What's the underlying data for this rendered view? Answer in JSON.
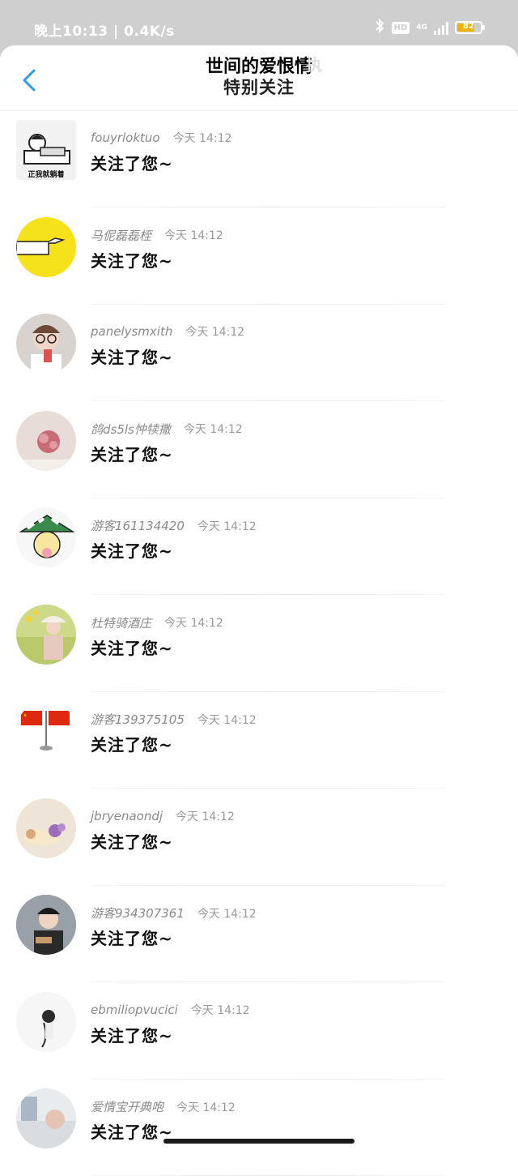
{
  "status_bar": {
    "time": "晚上10:13 | 0.4K/s",
    "hd": "HD",
    "network": "4G",
    "battery": "82",
    "battery_level": 0.82,
    "icons": [
      "bluetooth-icon",
      "hd-icon",
      "signal-icon",
      "battery-icon"
    ]
  },
  "header": {
    "title_main": "世间的爱恨情",
    "title_faded": "执",
    "subtitle": "特别关注",
    "back_icon": "chevron-left-icon"
  },
  "notifications": [
    {
      "name": "fouyrloktuo",
      "time": "今天 14:12",
      "message": "关注了您~",
      "avatar": "sleeping-cartoon",
      "avatar_color": "#f2f2f2",
      "avatar_text": "正我就躺着"
    },
    {
      "name": "马伲磊磊桎",
      "time": "今天 14:12",
      "message": "关注了您~",
      "avatar": "pointing-hand",
      "avatar_color": "#f5e21b"
    },
    {
      "name": "panelysmxith",
      "time": "今天 14:12",
      "message": "关注了您~",
      "avatar": "person-glasses",
      "avatar_color": "#d9d3cf"
    },
    {
      "name": "鸽ds5ls忡犊撒",
      "time": "今天 14:12",
      "message": "关注了您~",
      "avatar": "flower-bouquet",
      "avatar_color": "#e8dcd8"
    },
    {
      "name": "游客161134420",
      "time": "今天 14:12",
      "message": "关注了您~",
      "avatar": "cartoon-hat",
      "avatar_color": "#f7f7f7"
    },
    {
      "name": "杜特骑酒庄",
      "time": "今天 14:12",
      "message": "关注了您~",
      "avatar": "girl-field",
      "avatar_color": "#b9c96c"
    },
    {
      "name": "游客139375105",
      "time": "今天 14:12",
      "message": "关注了您~",
      "avatar": "flags",
      "avatar_color": "#ffffff"
    },
    {
      "name": "jbryenaondj",
      "time": "今天 14:12",
      "message": "关注了您~",
      "avatar": "still-life",
      "avatar_color": "#eee5d8"
    },
    {
      "name": "游客934307361",
      "time": "今天 14:12",
      "message": "关注了您~",
      "avatar": "person-dark",
      "avatar_color": "#8c8f95"
    },
    {
      "name": "ebmiliopvucici",
      "time": "今天 14:12",
      "message": "关注了您~",
      "avatar": "girl-sketch",
      "avatar_color": "#f6f6f6"
    },
    {
      "name": "爱情宝开典咆",
      "time": "今天 14:12",
      "message": "关注了您~",
      "avatar": "photo-partial",
      "avatar_color": "#e9ecef"
    }
  ]
}
